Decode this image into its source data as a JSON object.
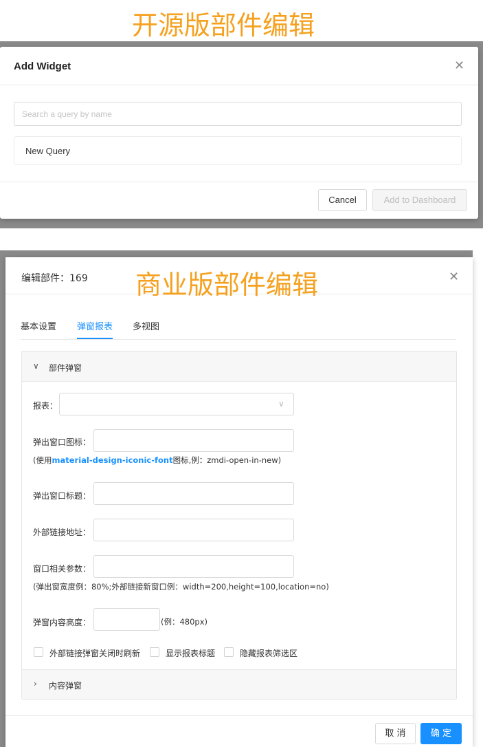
{
  "captions": {
    "top": "开源版部件编辑",
    "middle": "商业版部件编辑"
  },
  "open_source_dialog": {
    "title": "Add Widget",
    "search": {
      "placeholder": "Search a query by name",
      "value": ""
    },
    "list_items": [
      "New Query"
    ],
    "buttons": {
      "cancel": "Cancel",
      "add": "Add to Dashboard"
    }
  },
  "commercial_dialog": {
    "title": "编辑部件：169",
    "tabs": [
      {
        "label": "基本设置",
        "active": false
      },
      {
        "label": "弹窗报表",
        "active": true
      },
      {
        "label": "多视图",
        "active": false
      }
    ],
    "panel_popup": {
      "header": "部件弹窗",
      "fields": {
        "report": {
          "label": "报表：",
          "value": ""
        },
        "popup_icon": {
          "label": "弹出窗口图标：",
          "value": ""
        },
        "popup_icon_hint": {
          "prefix": "(使用",
          "link": "material-design-iconic-font",
          "suffix": "图标,例：zmdi-open-in-new)"
        },
        "popup_title": {
          "label": "弹出窗口标题：",
          "value": ""
        },
        "external_url": {
          "label": "外部链接地址：",
          "value": ""
        },
        "window_params": {
          "label": "窗口相关参数：",
          "value": ""
        },
        "window_params_hint": "(弹出窗宽度例：80%;外部链接新窗口例：width=200,height=100,location=no)",
        "content_height": {
          "label": "弹窗内容高度：",
          "value": "",
          "hint": "(例：480px)"
        }
      },
      "checkboxes": [
        {
          "label": "外部链接弹窗关闭时刷新",
          "checked": false
        },
        {
          "label": "显示报表标题",
          "checked": false
        },
        {
          "label": "隐藏报表筛选区",
          "checked": false
        }
      ]
    },
    "panel_content": {
      "header": "内容弹窗"
    },
    "buttons": {
      "cancel": "取 消",
      "ok": "确 定"
    }
  },
  "colors": {
    "accent": "#1890ff",
    "caption": "#f5a11f",
    "backdrop": "#8a8a8a",
    "bar": "#2042a8"
  }
}
